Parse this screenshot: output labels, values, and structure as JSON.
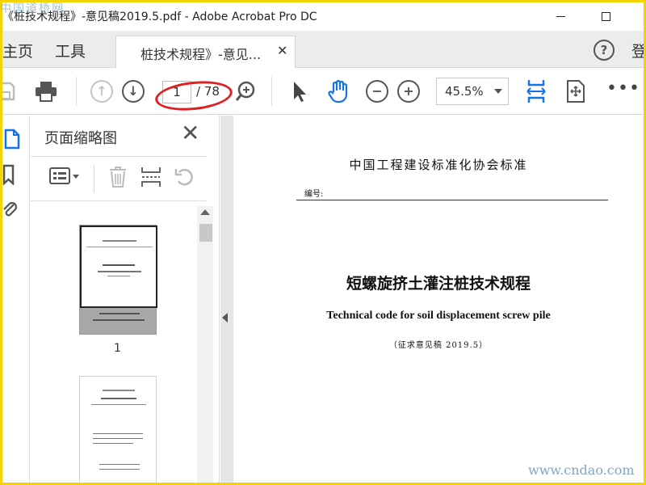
{
  "window": {
    "title": "《桩技术规程》-意见稿2019.5.pdf - Adobe Acrobat Pro DC"
  },
  "tabs": {
    "home": "主页",
    "tools": "工具",
    "document": "桩技术规程》-意见...",
    "sign_in": "登"
  },
  "toolbar": {
    "current_page": "1",
    "total_pages": "/ 78",
    "zoom": "45.5%"
  },
  "thumbnails": {
    "title": "页面缩略图",
    "items": [
      {
        "number": "1"
      }
    ]
  },
  "document": {
    "standard_body": "中国工程建设标准化协会标准",
    "number_label": "编号:",
    "title_cn": "短螺旋挤土灌注桩技术规程",
    "title_en": "Technical code for soil displacement screw pile",
    "draft_note": "（征求意见稿 2019.5）"
  },
  "watermarks": {
    "top_left": "中国道桥网",
    "bottom_right": "www.cndao.com"
  },
  "colors": {
    "frame_border": "#f4d400",
    "annotation_circle": "#e02020",
    "hand_tool_accent": "#1473e6"
  },
  "icons": [
    "save-icon",
    "print-icon",
    "prev-page-icon",
    "next-page-icon",
    "find-zoom-icon",
    "select-arrow-icon",
    "hand-tool-icon",
    "zoom-out-icon",
    "zoom-in-icon",
    "fit-width-icon",
    "scroll-mode-icon",
    "more-icon",
    "help-icon",
    "page-thumbnails-icon",
    "bookmark-icon",
    "attachment-icon",
    "thumbnail-options-icon",
    "delete-page-icon",
    "insert-page-icon",
    "rotate-page-icon"
  ]
}
